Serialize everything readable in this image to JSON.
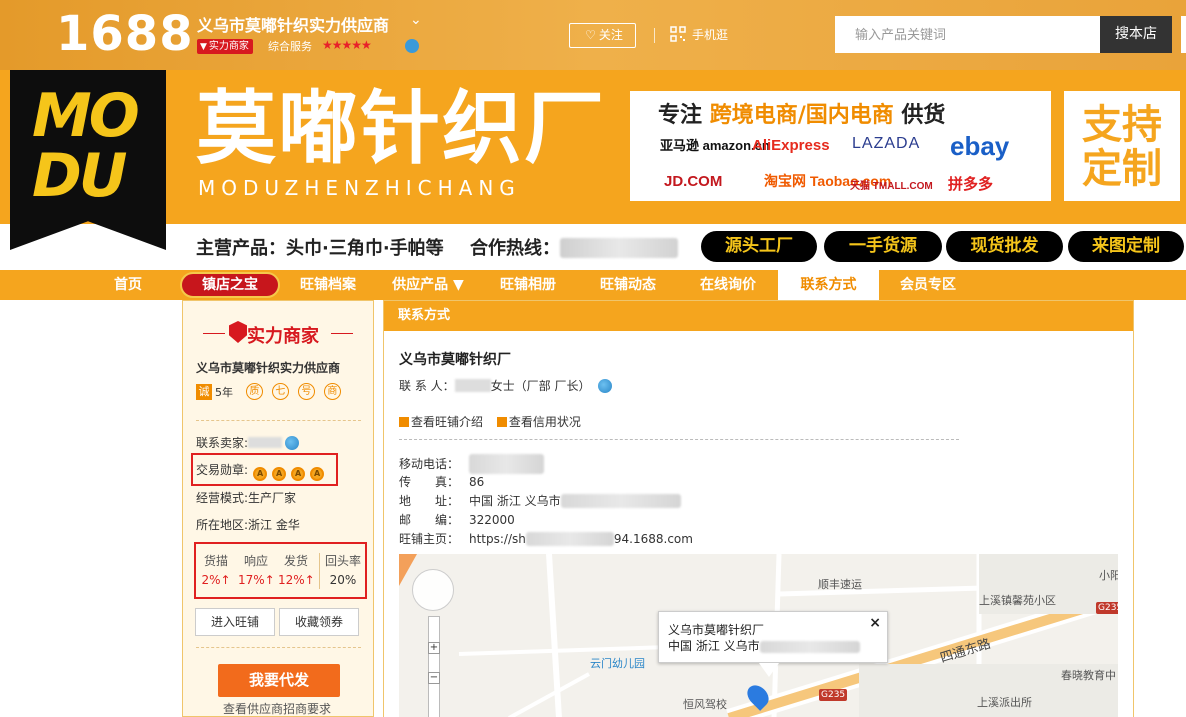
{
  "topbar": {
    "logo": "1688",
    "shop_name": "义乌市莫嘟针织实力供应商",
    "badge": "实力商家",
    "service_label": "综合服务",
    "stars": "★★★★★",
    "follow_label": "关注",
    "mobile_label": "手机逛",
    "search_placeholder": "输入产品关键词",
    "search_button": "搜本店"
  },
  "banner": {
    "logo_text": "MO DU",
    "brand_cn": "莫嘟针织厂",
    "brand_en": "MODUZHENZHICHANG",
    "promo_prefix": "专注",
    "promo_highlight": "跨境电商/国内电商",
    "promo_suffix": "供货",
    "platforms": [
      "亚马逊 amazon.cn",
      "AliExpress",
      "LAZADA",
      "ebay",
      "JD.COM",
      "淘宝网 Taobao.com",
      "天猫 TMALL.COM",
      "拼多多"
    ],
    "custom_label": "支持定制",
    "main_products": "主营产品：头巾·三角巾·手帕等",
    "hotline_label": "合作热线：",
    "pills": [
      "源头工厂",
      "一手货源",
      "现货批发",
      "来图定制"
    ]
  },
  "nav": {
    "items": [
      "首页",
      "镇店之宝",
      "旺铺档案",
      "供应产品 ▼",
      "旺铺相册",
      "旺铺动态",
      "在线询价",
      "联系方式",
      "会员专区"
    ],
    "active_index": 7
  },
  "sidebar": {
    "header": "实力商家",
    "company": "义乌市莫嘟针织实力供应商",
    "cheng_mark": "诚",
    "years": "5年",
    "seals": [
      "质",
      "七",
      "号",
      "商"
    ],
    "contact_seller_label": "联系卖家:",
    "medal_label": "交易勋章:",
    "medal_count": 4,
    "business_mode": "经营模式:生产厂家",
    "region": "所在地区:浙江 金华",
    "stats": [
      {
        "label": "货描",
        "value": "2%↑"
      },
      {
        "label": "响应",
        "value": "17%↑"
      },
      {
        "label": "发货",
        "value": "12%↑"
      },
      {
        "label": "回头率",
        "value": "20%"
      }
    ],
    "enter_shop": "进入旺铺",
    "favorite": "收藏领券",
    "daifa": "我要代发",
    "daifa_sub": "查看供应商招商要求"
  },
  "main": {
    "title": "联系方式",
    "company_name": "义乌市莫嘟针织厂",
    "contact_label": "联 系 人：",
    "contact_suffix": "女士（厂部 厂长）",
    "links": [
      "查看旺铺介绍",
      "查看信用状况"
    ],
    "mobile_label": "移动电话：",
    "fax_label": "传　　真：",
    "fax_value": "86",
    "address_label": "地　　址：",
    "address_value": "中国 浙江 义乌市",
    "postcode_label": "邮　　编：",
    "postcode_value": "322000",
    "homepage_label": "旺铺主页：",
    "homepage_prefix": "https://sh",
    "homepage_suffix": "94.1688.com"
  },
  "map": {
    "labels": [
      "顺丰速运",
      "上溪镇馨苑小区",
      "小阳",
      "云门幼儿园",
      "四通东路",
      "春晓教育中",
      "上溪派出所",
      "恒风驾校"
    ],
    "road_signs": [
      "G235",
      "G235"
    ],
    "popup_title": "义乌市莫嘟针织厂",
    "popup_addr": "中国 浙江 义乌市",
    "popup_close": "×",
    "zoom_in": "+",
    "zoom_out": "−"
  },
  "colors": {
    "accent": "#f5a51e",
    "topbar": "#e9a33a",
    "red": "#e02020",
    "dark": "#333333"
  }
}
